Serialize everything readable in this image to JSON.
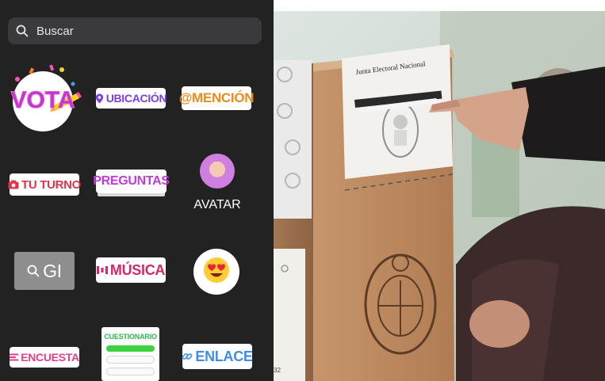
{
  "search": {
    "placeholder": "Buscar",
    "icon": "search-icon"
  },
  "stickers": {
    "vota": "VOTA",
    "ubicacion": "UBICACIÓN",
    "mencion": "@MENCIÓN",
    "tu_turno": "TU TURNO",
    "preguntas": "PREGUNTAS",
    "avatar": "AVATAR",
    "gif": "GI",
    "musica": "MÚSICA",
    "emoji": "heart-eyes",
    "encuesta": "ENCUESTA",
    "cuestionario": "CUESTIONARIO",
    "enlace": "ENLACE"
  },
  "photo": {
    "ballot_box_label": "Junta Electoral Nacional",
    "box_number": "32"
  },
  "colors": {
    "tray_background": "#222222",
    "search_background": "#3a3a3c",
    "ubicacion": "#7b3fe4",
    "mencion": "#ef8a1a",
    "tu_turno": "#e0344a",
    "preguntas": "#c23ad6",
    "musica": "#d6266d",
    "encuesta": "#e23f8a",
    "cuestionario": "#2fb84f",
    "enlace": "#3d8fe6"
  }
}
